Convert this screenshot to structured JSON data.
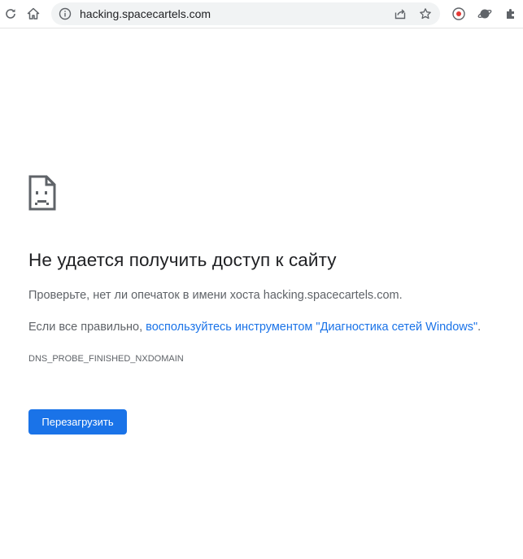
{
  "toolbar": {
    "icons": [
      "reload-icon",
      "home-icon",
      "info-icon",
      "share-icon",
      "star-icon",
      "record-extension-icon",
      "planet-extension-icon",
      "puzzle-extensions-icon"
    ],
    "url": "hacking.spacecartels.com"
  },
  "error_page": {
    "icon": "sad-page-icon",
    "title": "Не удается получить доступ к сайту",
    "check_text": "Проверьте, нет ли опечаток в имени хоста hacking.spacecartels.com.",
    "diag_prefix": "Если все правильно, ",
    "diag_link": "воспользуйтесь инструментом \"Диагностика сетей Windows\"",
    "diag_suffix": ".",
    "error_code": "DNS_PROBE_FINISHED_NXDOMAIN",
    "reload_label": "Перезагрузить",
    "accent_color": "#1a73e8",
    "text_color": "#5f6368"
  }
}
